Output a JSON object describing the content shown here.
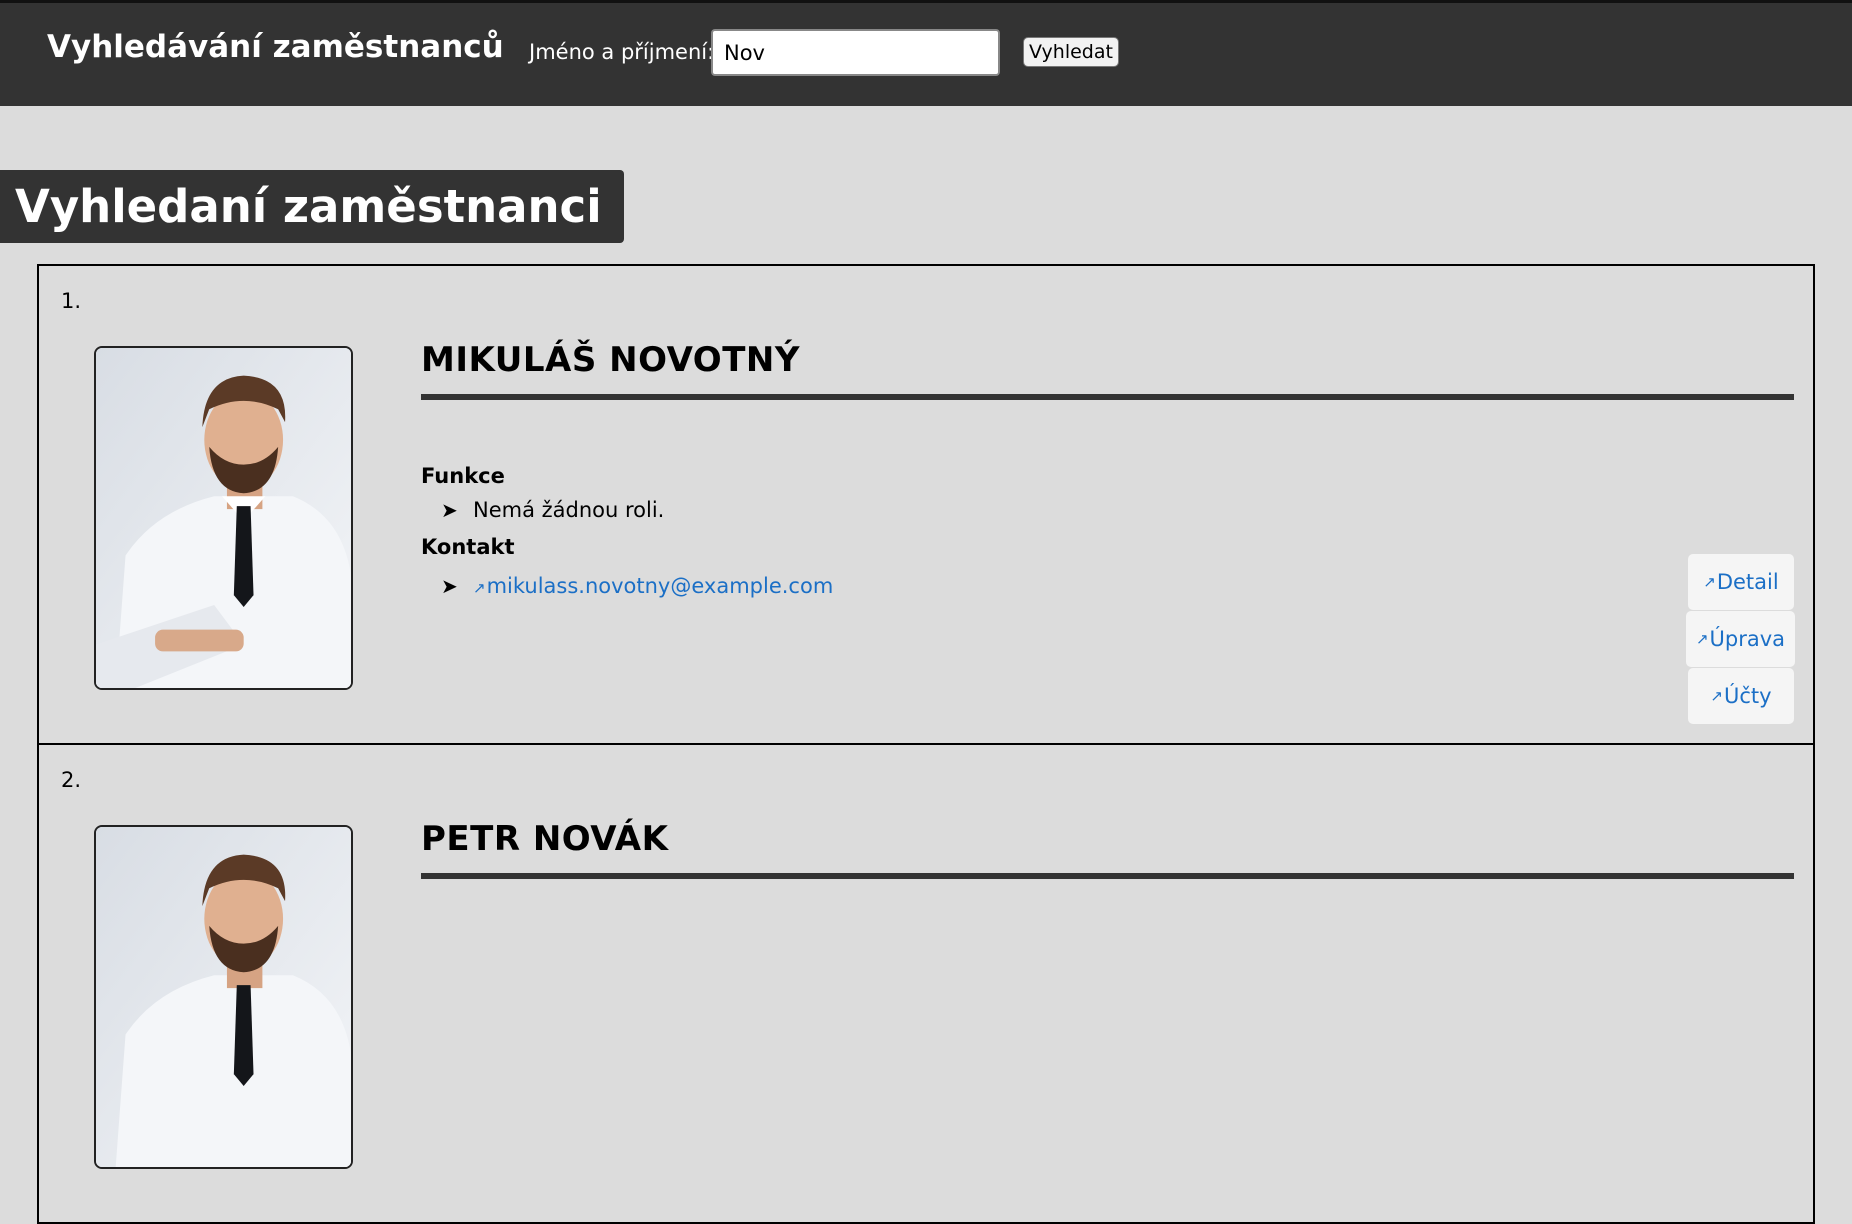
{
  "header": {
    "title": "Vyhledávání zaměstnanců",
    "search_label": "Jméno a příjmení:",
    "search_value": "Nov",
    "search_button": "Vyhledat"
  },
  "page": {
    "heading": "Vyhledaní zaměstnanci"
  },
  "results": [
    {
      "number": "1.",
      "name": "MIKULÁŠ NOVOTNÝ",
      "function_label": "Funkce",
      "function_value": "Nemá žádnou roli.",
      "contact_label": "Kontakt",
      "email": "mikulass.novotny@example.com",
      "bullet_glyph": "➤",
      "link_glyph": "↗",
      "actions": {
        "detail": "Detail",
        "edit": "Úprava",
        "accounts": "Účty"
      },
      "photo_icon": "employee-photo"
    },
    {
      "number": "2.",
      "name": "PETR NOVÁK",
      "photo_icon": "employee-photo"
    }
  ],
  "colors": {
    "header_bg": "#333333",
    "page_bg": "#dcdcdc",
    "link": "#1b6fc6"
  }
}
